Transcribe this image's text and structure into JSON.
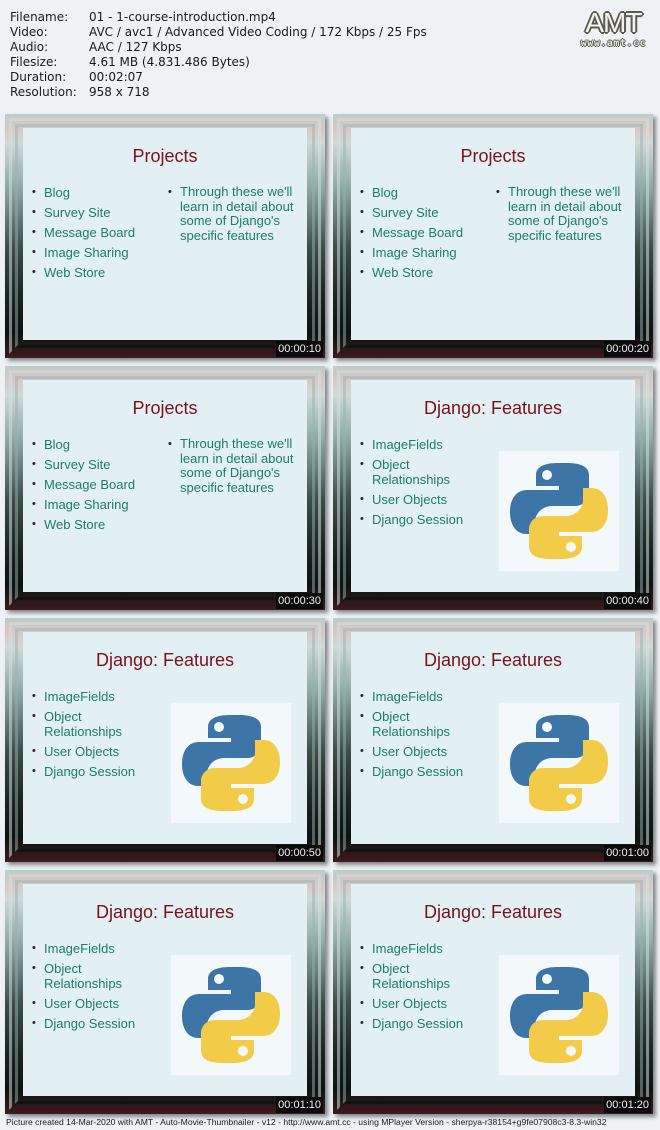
{
  "info": [
    {
      "label": "Filename:",
      "value": "01 - 1-course-introduction.mp4"
    },
    {
      "label": "Video:",
      "value": "AVC / avc1 / Advanced Video Coding / 172 Kbps / 25 Fps"
    },
    {
      "label": "Audio:",
      "value": "AAC / 127 Kbps"
    },
    {
      "label": "Filesize:",
      "value": "4.61 MB (4.831.486 Bytes)"
    },
    {
      "label": "Duration:",
      "value": "00:02:07"
    },
    {
      "label": "Resolution:",
      "value": "958 x 718"
    }
  ],
  "logo": {
    "main": "AMT",
    "url": "www.amt.cc"
  },
  "colors": {
    "title": "#7a1020",
    "bullet_text": "#1f7b6c",
    "slide_bg": "#e2f0f3",
    "python_blue": "#3d75a6",
    "python_yellow": "#f2cc48"
  },
  "thumbnails": [
    {
      "timestamp": "00:00:10",
      "title": "Projects",
      "bullets": [
        "Blog",
        "Survey Site",
        "Message Board",
        "Image Sharing",
        "Web Store"
      ],
      "note": "Through these we'll learn in detail about some of Django's specific features"
    },
    {
      "timestamp": "00:00:20",
      "title": "Projects",
      "bullets": [
        "Blog",
        "Survey Site",
        "Message Board",
        "Image Sharing",
        "Web Store"
      ],
      "note": "Through these we'll learn in detail about some of Django's specific features"
    },
    {
      "timestamp": "00:00:30",
      "title": "Projects",
      "bullets": [
        "Blog",
        "Survey Site",
        "Message Board",
        "Image Sharing",
        "Web Store"
      ],
      "note": "Through these we'll learn in detail about some of Django's specific features"
    },
    {
      "timestamp": "00:00:40",
      "title": "Django: Features",
      "bullets": [
        "ImageFields",
        "Object Relationships",
        "User Objects",
        "Django Session"
      ],
      "image": "python-logo"
    },
    {
      "timestamp": "00:00:50",
      "title": "Django: Features",
      "bullets": [
        "ImageFields",
        "Object Relationships",
        "User Objects",
        "Django Session"
      ],
      "image": "python-logo"
    },
    {
      "timestamp": "00:01:00",
      "title": "Django: Features",
      "bullets": [
        "ImageFields",
        "Object Relationships",
        "User Objects",
        "Django Session"
      ],
      "image": "python-logo"
    },
    {
      "timestamp": "00:01:10",
      "title": "Django: Features",
      "bullets": [
        "ImageFields",
        "Object Relationships",
        "User Objects",
        "Django Session"
      ],
      "image": "python-logo"
    },
    {
      "timestamp": "00:01:20",
      "title": "Django: Features",
      "bullets": [
        "ImageFields",
        "Object Relationships",
        "User Objects",
        "Django Session"
      ],
      "image": "python-logo"
    }
  ],
  "footer": "Picture created 14-Mar-2020 with AMT - Auto-Movie-Thumbnailer - v12 - http://www.amt.cc - using MPlayer Version - sherpya-r38154+g9fe07908c3-8.3-win32"
}
